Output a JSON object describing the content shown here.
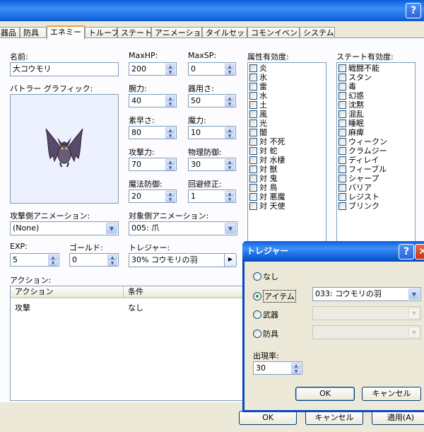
{
  "window": {
    "help_button": "?"
  },
  "tabs": [
    "器品",
    "防具",
    "エネミー",
    "トループ",
    "ステート",
    "アニメーション",
    "タイルセット",
    "コモンイベント",
    "システム"
  ],
  "enemy": {
    "name_label": "名前:",
    "name": "大コウモリ",
    "battler_label": "バトラー グラフィック:",
    "maxhp_label": "MaxHP:",
    "maxhp": "200",
    "maxsp_label": "MaxSP:",
    "maxsp": "0",
    "str_label": "腕力:",
    "str": "40",
    "dex_label": "器用さ:",
    "dex": "50",
    "agi_label": "素早さ:",
    "agi": "80",
    "int_label": "魔力:",
    "int": "10",
    "atk_label": "攻撃力:",
    "atk": "70",
    "pdef_label": "物理防御:",
    "pdef": "30",
    "mdef_label": "魔法防御:",
    "mdef": "20",
    "eva_label": "回避修正:",
    "eva": "1",
    "attack_anim_label": "攻撃側アニメーション:",
    "attack_anim": "(None)",
    "target_anim_label": "対象側アニメーション:",
    "target_anim": "005: 爪",
    "exp_label": "EXP:",
    "exp": "5",
    "gold_label": "ゴールド:",
    "gold": "0",
    "treasure_label": "トレジャー:",
    "treasure": "30%  コウモリの羽",
    "treasure_button": "▶"
  },
  "element_label": "属性有効度:",
  "elements": [
    "炎",
    "氷",
    "雷",
    "水",
    "土",
    "風",
    "光",
    "闇",
    "対 不死",
    "対 蛇",
    "対 水棲",
    "対 獣",
    "対 鬼",
    "対 鳥",
    "対 悪魔",
    "対 天使"
  ],
  "state_label": "ステート有効度:",
  "states": [
    "戦闘不能",
    "スタン",
    "毒",
    "幻惑",
    "沈黙",
    "混乱",
    "睡眠",
    "麻痺",
    "ウィークン",
    "クラムジー",
    "ディレイ",
    "フィーブル",
    "シャープ",
    "バリア",
    "レジスト",
    "ブリンク"
  ],
  "actions": {
    "label": "アクション:",
    "col_action": "アクション",
    "col_condition": "条件",
    "rows": [
      {
        "action": "攻撃",
        "condition": "なし"
      }
    ]
  },
  "dialog": {
    "title": "トレジャー",
    "help": "?",
    "close": "✕",
    "opt_none": "なし",
    "opt_item": "アイテム",
    "item_value": "033: コウモリの羽",
    "opt_weapon": "武器",
    "opt_armor": "防具",
    "rate_label": "出現率:",
    "rate": "30",
    "ok": "OK",
    "cancel": "キャンセル"
  },
  "footer": {
    "ok": "OK",
    "cancel": "キャンセル",
    "apply": "適用(A)"
  },
  "colors": {
    "accent": "#0a5fdc",
    "selected_tab_top": "#e8a43b",
    "bat_body": "#5a4a6a"
  }
}
